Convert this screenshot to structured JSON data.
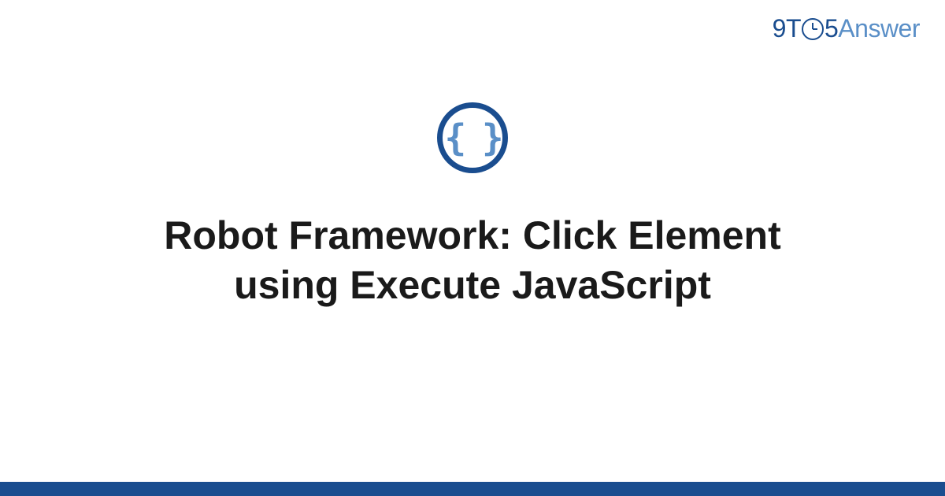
{
  "brand": {
    "part1": "9T",
    "part2": "5",
    "part3": "Answer"
  },
  "icon": {
    "braces_text": "{ }"
  },
  "title": "Robot Framework: Click Element using Execute JavaScript"
}
